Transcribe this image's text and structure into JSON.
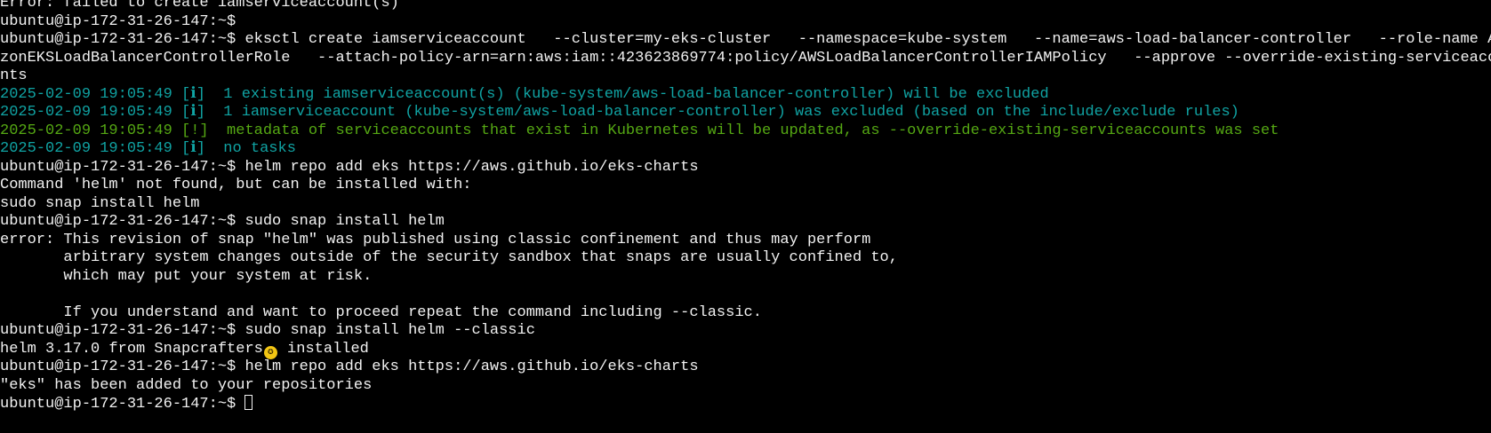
{
  "terminal": {
    "colors": {
      "background": "#000000",
      "text": "#f2f2f2",
      "info": "#10a3a3",
      "warning": "#55a813",
      "badge": "#f3c613"
    },
    "lines": [
      {
        "text": "Error: failed to create iamserviceaccount(s)",
        "color": "white"
      },
      {
        "text": "ubuntu@ip-172-31-26-147:~$",
        "color": "white"
      },
      {
        "text": "ubuntu@ip-172-31-26-147:~$ eksctl create iamserviceaccount   --cluster=my-eks-cluster   --namespace=kube-system   --name=aws-load-balancer-controller   --role-name Ama",
        "color": "white"
      },
      {
        "text": "zonEKSLoadBalancerControllerRole   --attach-policy-arn=arn:aws:iam::423623869774:policy/AWSLoadBalancerControllerIAMPolicy   --approve --override-existing-serviceaccou",
        "color": "white"
      },
      {
        "text": "nts",
        "color": "white"
      },
      {
        "text": "2025-02-09 19:05:49 [ℹ]  1 existing iamserviceaccount(s) (kube-system/aws-load-balancer-controller) will be excluded",
        "color": "cyan"
      },
      {
        "text": "2025-02-09 19:05:49 [ℹ]  1 iamserviceaccount (kube-system/aws-load-balancer-controller) was excluded (based on the include/exclude rules)",
        "color": "cyan"
      },
      {
        "text": "2025-02-09 19:05:49 [!]  metadata of serviceaccounts that exist in Kubernetes will be updated, as --override-existing-serviceaccounts was set",
        "color": "green"
      },
      {
        "text": "2025-02-09 19:05:49 [ℹ]  no tasks",
        "color": "cyan"
      },
      {
        "text": "ubuntu@ip-172-31-26-147:~$ helm repo add eks https://aws.github.io/eks-charts",
        "color": "white"
      },
      {
        "text": "Command 'helm' not found, but can be installed with:",
        "color": "white"
      },
      {
        "text": "sudo snap install helm",
        "color": "white"
      },
      {
        "text": "ubuntu@ip-172-31-26-147:~$ sudo snap install helm",
        "color": "white"
      },
      {
        "text": "error: This revision of snap \"helm\" was published using classic confinement and thus may perform",
        "color": "white"
      },
      {
        "text": "       arbitrary system changes outside of the security sandbox that snaps are usually confined to,",
        "color": "white"
      },
      {
        "text": "       which may put your system at risk.",
        "color": "white"
      },
      {
        "text": "",
        "color": "white"
      },
      {
        "text": "       If you understand and want to proceed repeat the command including --classic.",
        "color": "white"
      },
      {
        "text": "ubuntu@ip-172-31-26-147:~$ sudo snap install helm --classic",
        "color": "white"
      }
    ],
    "install_line": {
      "before": "helm 3.17.0 from Snapcrafters",
      "badge": "✪",
      "after": " installed"
    },
    "lines_after": [
      {
        "text": "ubuntu@ip-172-31-26-147:~$ helm repo add eks https://aws.github.io/eks-charts",
        "color": "white"
      },
      {
        "text": "\"eks\" has been added to your repositories",
        "color": "white"
      }
    ],
    "prompt": {
      "text": "ubuntu@ip-172-31-26-147:~$ ",
      "input": ""
    }
  }
}
